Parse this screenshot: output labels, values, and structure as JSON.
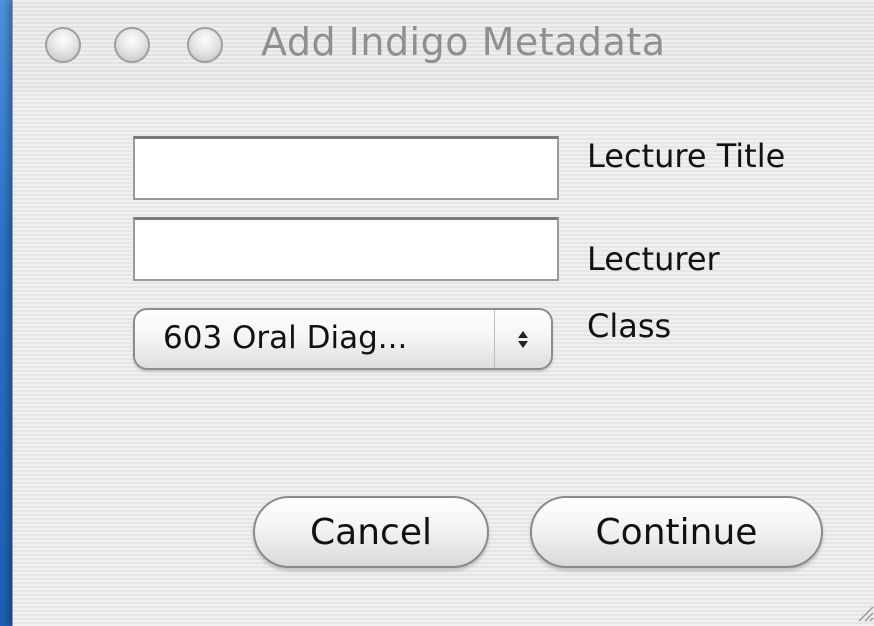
{
  "window": {
    "title": "Add Indigo Metadata",
    "buttons": [
      "close",
      "minimize",
      "zoom"
    ]
  },
  "form": {
    "lecture_title": {
      "label": "Lecture Title",
      "value": ""
    },
    "lecturer": {
      "label": "Lecturer",
      "value": ""
    },
    "class": {
      "label": "Class",
      "selected": "603 Oral Diag..."
    }
  },
  "actions": {
    "cancel_label": "Cancel",
    "continue_label": "Continue"
  },
  "colors": {
    "desktop_blue": "#2b72c6",
    "window_bg": "#ececec",
    "title_text": "#8f8f8f"
  }
}
